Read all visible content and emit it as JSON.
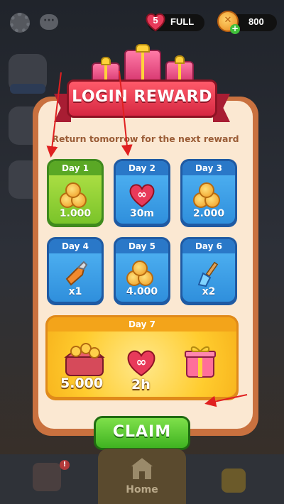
{
  "hud": {
    "lives_count": "5",
    "lives_status": "FULL",
    "coins": "800"
  },
  "modal": {
    "title": "LOGIN REWARD",
    "subtitle": "Return tomorrow for the next reward",
    "days": [
      {
        "label": "Day 1",
        "amount": "1.000",
        "reward": "coins",
        "claimed": true
      },
      {
        "label": "Day 2",
        "amount": "30m",
        "reward": "infinite-lives"
      },
      {
        "label": "Day 3",
        "amount": "2.000",
        "reward": "coins"
      },
      {
        "label": "Day 4",
        "amount": "x1",
        "reward": "drill-booster"
      },
      {
        "label": "Day 5",
        "amount": "4.000",
        "reward": "coins"
      },
      {
        "label": "Day 6",
        "amount": "x2",
        "reward": "broom-booster"
      }
    ],
    "day7": {
      "label": "Day 7",
      "coins_amount": "5.000",
      "lives_amount": "2h",
      "reward_icons": [
        "treasure-chest-icon",
        "infinite-heart-icon",
        "gift-box-icon"
      ]
    },
    "claim_label": "CLAIM"
  },
  "nav": {
    "home_label": "Home",
    "notification_badge": "!"
  },
  "colors": {
    "claimed_green": "#7ac42a",
    "day_blue": "#2f8fdc",
    "banner_red": "#d62842",
    "claim_green": "#3fb321",
    "day7_gold": "#ffcc2e",
    "annotation_arrow": "#e02020"
  }
}
